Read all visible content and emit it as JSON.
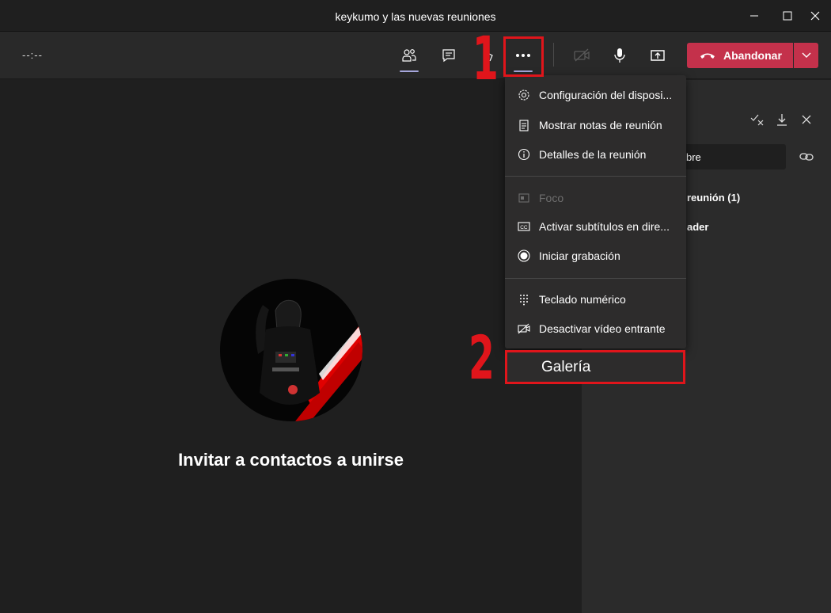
{
  "window": {
    "title": "keykumo y las nuevas reuniones"
  },
  "toolbar": {
    "timer": "--:--",
    "leave_label": "Abandonar"
  },
  "menu": {
    "items": [
      {
        "label": "Configuración del disposi...",
        "icon": "gear-icon",
        "disabled": false
      },
      {
        "label": "Mostrar notas de reunión",
        "icon": "notes-icon",
        "disabled": false
      },
      {
        "label": "Detalles de la reunión",
        "icon": "info-icon",
        "disabled": false
      },
      {
        "label": "Foco",
        "icon": "focus-icon",
        "disabled": true
      },
      {
        "label": "Activar subtítulos en dire...",
        "icon": "cc-icon",
        "disabled": false
      },
      {
        "label": "Iniciar grabación",
        "icon": "record-icon",
        "disabled": false
      },
      {
        "label": "Teclado numérico",
        "icon": "dialpad-icon",
        "disabled": false
      },
      {
        "label": "Desactivar vídeo entrante",
        "icon": "video-off-icon",
        "disabled": false
      }
    ],
    "highlighted_item": "Galería"
  },
  "stage": {
    "invite_text": "Invitar a contactos a unirse"
  },
  "panel": {
    "input_partial": "bre",
    "section_partial": "reunión (1)",
    "participant_partial": "ader"
  },
  "annotations": {
    "step1": "1",
    "step2": "2"
  },
  "colors": {
    "leave": "#c4314b",
    "annotation_red": "#e0151b",
    "accent": "#a6a7dc"
  }
}
